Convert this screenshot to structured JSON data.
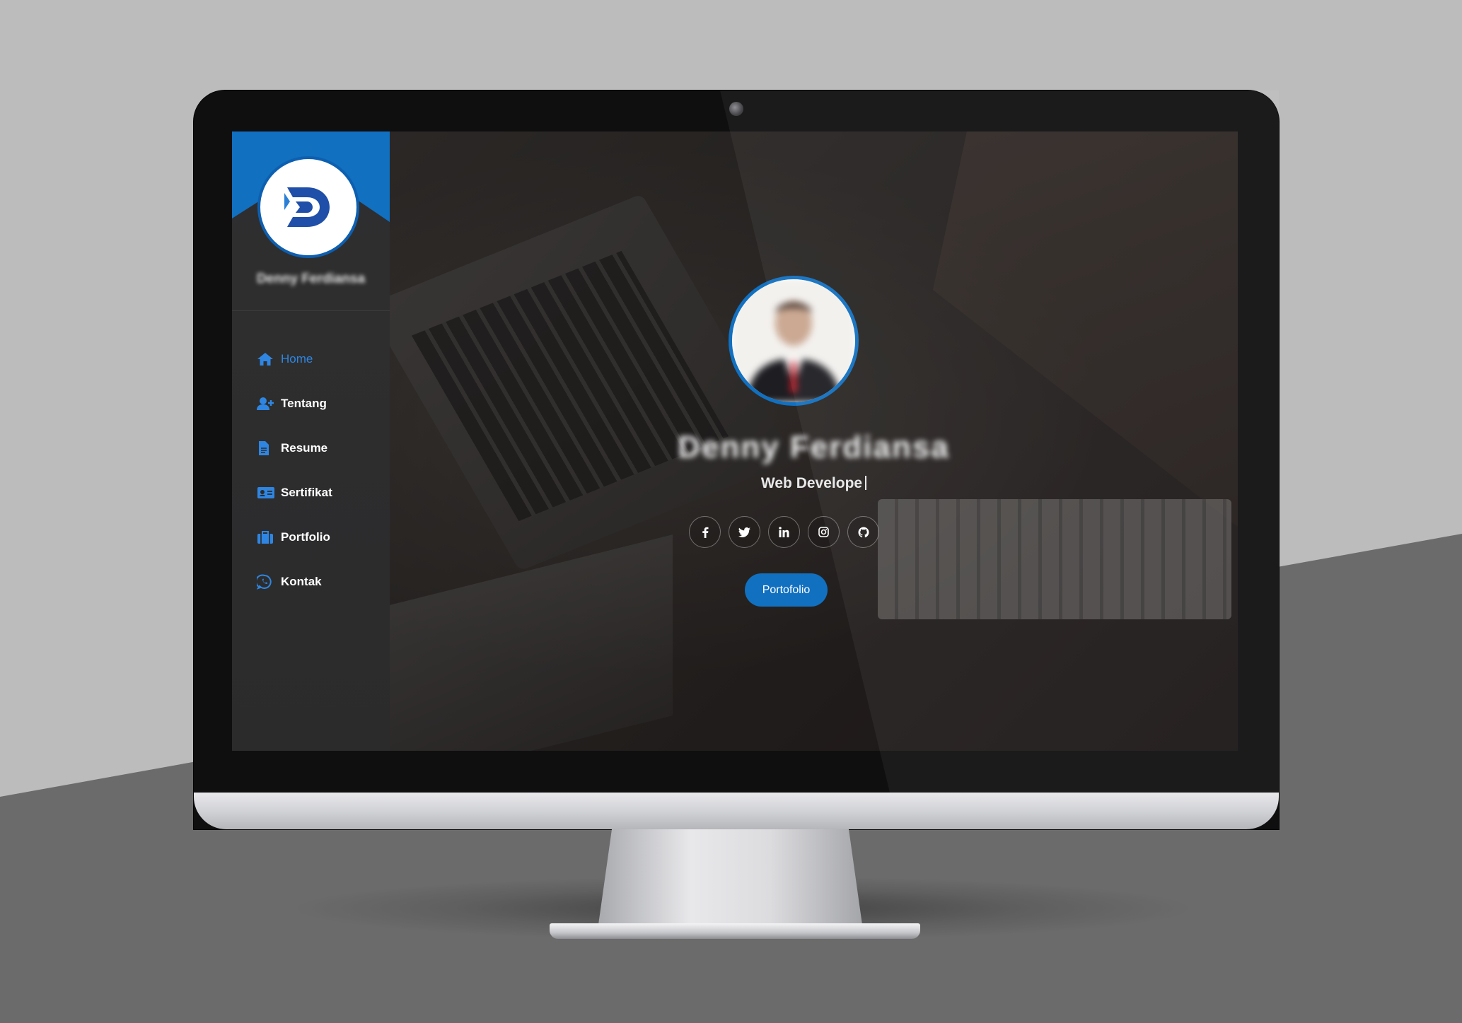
{
  "sidebar": {
    "profile_name": "Denny Ferdiansa",
    "nav": [
      {
        "label": "Home",
        "icon": "home-icon",
        "active": true
      },
      {
        "label": "Tentang",
        "icon": "user-plus-icon",
        "active": false
      },
      {
        "label": "Resume",
        "icon": "document-icon",
        "active": false
      },
      {
        "label": "Sertifikat",
        "icon": "id-card-icon",
        "active": false
      },
      {
        "label": "Portfolio",
        "icon": "briefcase-icon",
        "active": false
      },
      {
        "label": "Kontak",
        "icon": "whatsapp-icon",
        "active": false
      }
    ]
  },
  "hero": {
    "name": "Denny Ferdiansa",
    "role": "Web Develope",
    "socials": [
      "facebook-icon",
      "twitter-icon",
      "linkedin-icon",
      "instagram-icon",
      "github-icon"
    ],
    "cta_label": "Portofolio"
  },
  "colors": {
    "accent": "#1170c0",
    "active_nav": "#2f86e2",
    "sidebar_bg": "#2d2d2e"
  }
}
